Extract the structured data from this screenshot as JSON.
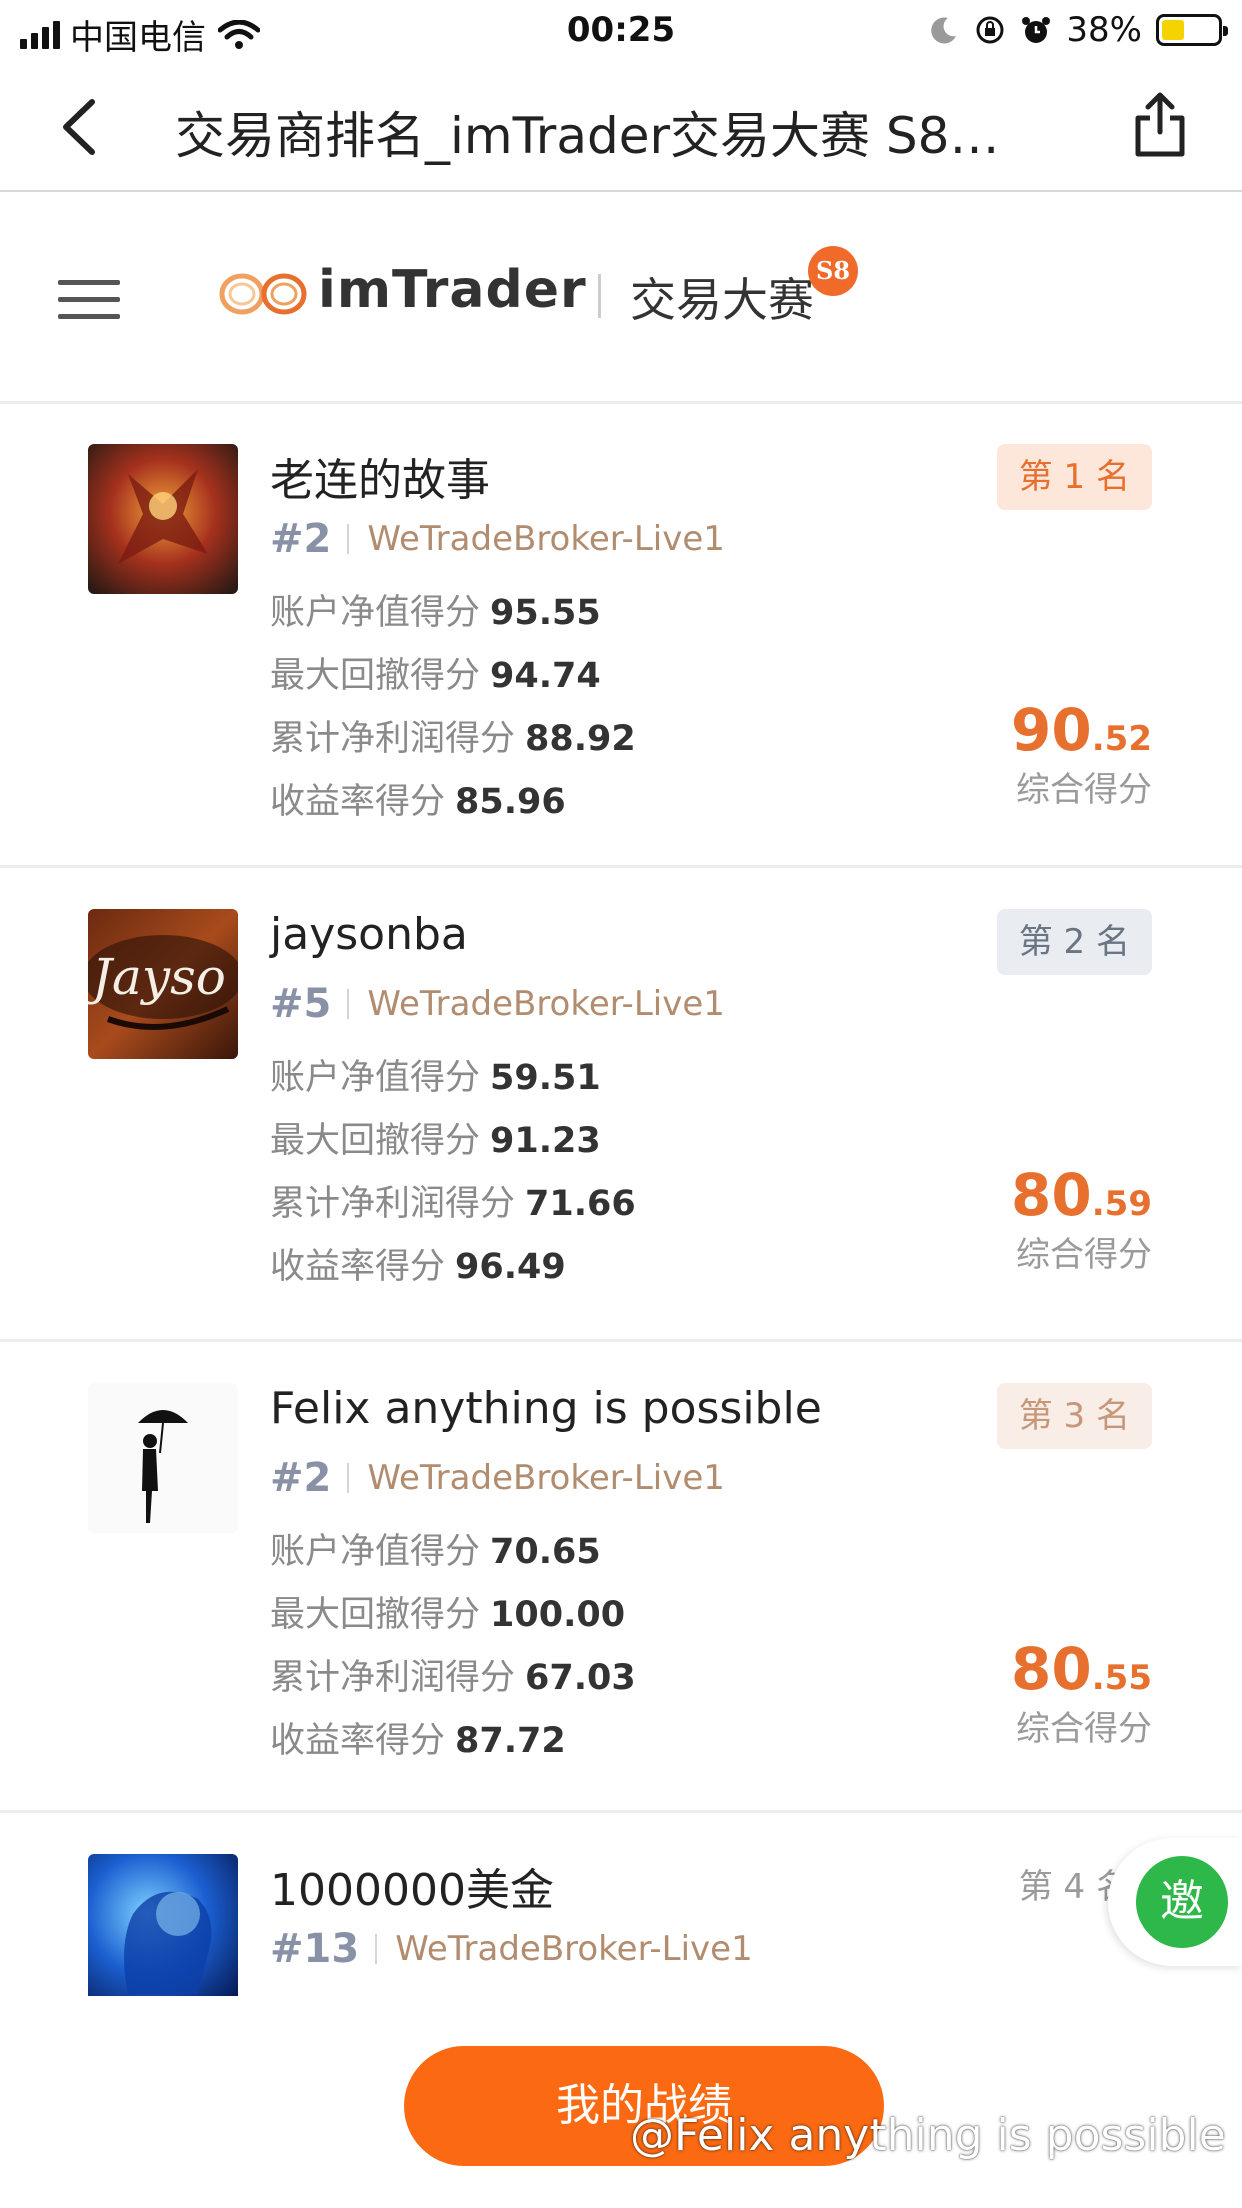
{
  "status_bar": {
    "carrier": "中国电信",
    "time": "00:25",
    "battery": "38%"
  },
  "nav": {
    "title": "交易商排名_imTrader交易大赛 S8…",
    "back_icon": "chevron-left-icon",
    "share_icon": "share-icon"
  },
  "brand": {
    "logo_text": "imTrader",
    "contest": "交易大赛",
    "season_badge": "S8"
  },
  "rankings": [
    {
      "name": "老连的故事",
      "number": "#2",
      "broker": "WeTradeBroker-Live1",
      "rank_label": "第 1 名",
      "scores": [
        {
          "label": "账户净值得分",
          "value": "95.55"
        },
        {
          "label": "最大回撤得分",
          "value": "94.74"
        },
        {
          "label": "累计净利润得分",
          "value": "88.92"
        },
        {
          "label": "收益率得分",
          "value": "85.96"
        }
      ],
      "total_int": "90",
      "total_dec": ".52",
      "total_label": "综合得分"
    },
    {
      "name": "jaysonba",
      "number": "#5",
      "broker": "WeTradeBroker-Live1",
      "rank_label": "第 2 名",
      "scores": [
        {
          "label": "账户净值得分",
          "value": "59.51"
        },
        {
          "label": "最大回撤得分",
          "value": "91.23"
        },
        {
          "label": "累计净利润得分",
          "value": "71.66"
        },
        {
          "label": "收益率得分",
          "value": "96.49"
        }
      ],
      "total_int": "80",
      "total_dec": ".59",
      "total_label": "综合得分"
    },
    {
      "name": "Felix anything is possible",
      "number": "#2",
      "broker": "WeTradeBroker-Live1",
      "rank_label": "第 3 名",
      "scores": [
        {
          "label": "账户净值得分",
          "value": "70.65"
        },
        {
          "label": "最大回撤得分",
          "value": "100.00"
        },
        {
          "label": "累计净利润得分",
          "value": "67.03"
        },
        {
          "label": "收益率得分",
          "value": "87.72"
        }
      ],
      "total_int": "80",
      "total_dec": ".55",
      "total_label": "综合得分"
    },
    {
      "name": "1000000美金",
      "number": "#13",
      "broker": "WeTradeBroker-Live1",
      "rank_label": "第 4 名"
    }
  ],
  "invite_label": "邀",
  "my_button": "我的战绩",
  "watermark": "@Felix anything is possible",
  "colors": {
    "accent": "#fb6a12",
    "score_orange": "#e8702f",
    "invite_green": "#2fb84a"
  }
}
